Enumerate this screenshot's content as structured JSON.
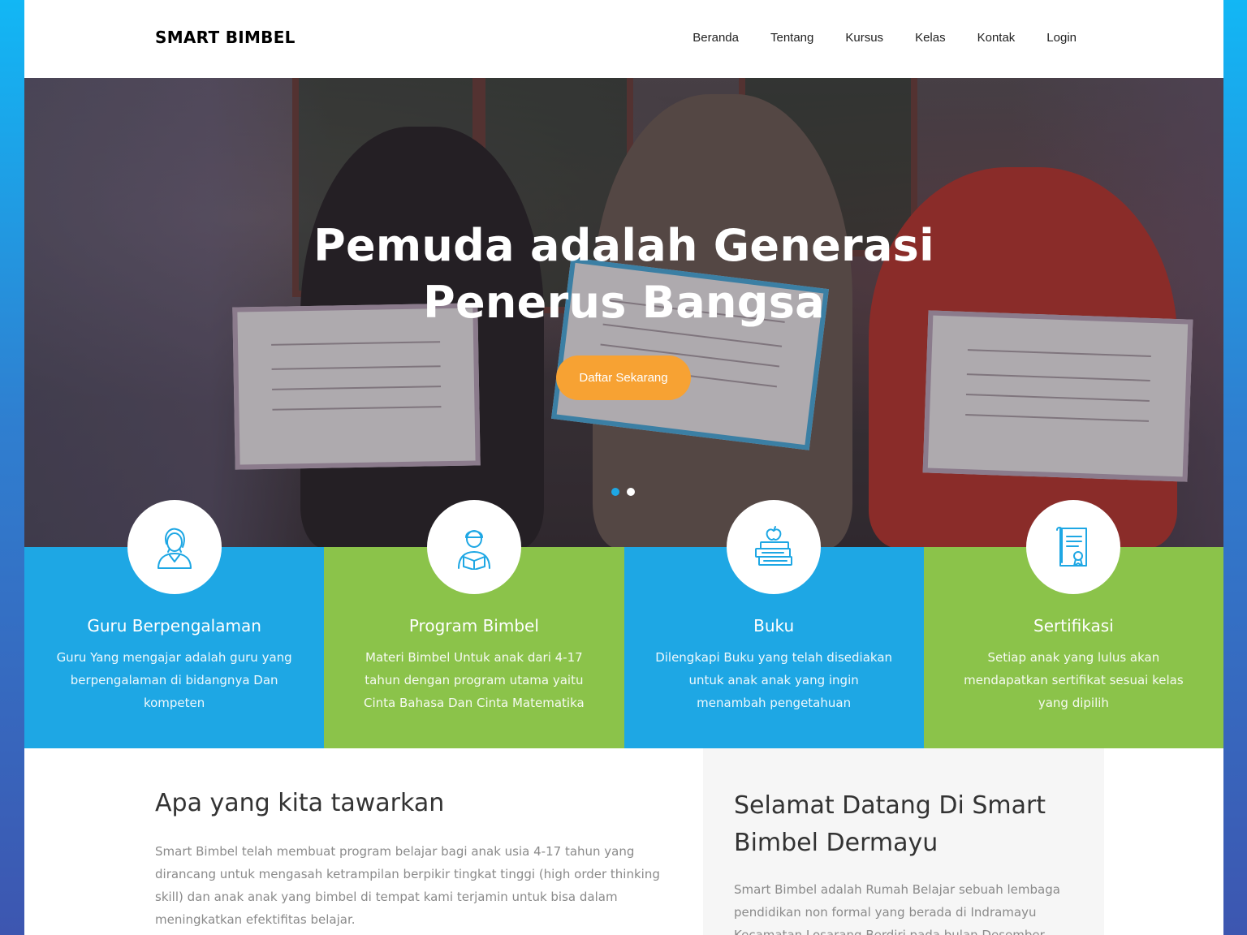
{
  "site": {
    "logo": "SMART BIMBEL"
  },
  "nav": {
    "items": [
      {
        "label": "Beranda"
      },
      {
        "label": "Tentang"
      },
      {
        "label": "Kursus"
      },
      {
        "label": "Kelas"
      },
      {
        "label": "Kontak"
      },
      {
        "label": "Login"
      }
    ]
  },
  "hero": {
    "title_line1": "Pemuda adalah Generasi",
    "title_line2": "Penerus Bangsa",
    "cta_label": "Daftar Sekarang",
    "slides": 2,
    "active_slide": 1
  },
  "features": [
    {
      "icon": "teacher-icon",
      "title": "Guru Berpengalaman",
      "text": "Guru Yang mengajar adalah guru yang berpengalaman di bidangnya Dan kompeten",
      "color": "#1ea7e4"
    },
    {
      "icon": "student-reading-icon",
      "title": "Program Bimbel",
      "text": "Materi Bimbel Untuk anak dari 4-17 tahun dengan program utama yaitu Cinta Bahasa Dan Cinta Matematika",
      "color": "#8bc34a"
    },
    {
      "icon": "books-apple-icon",
      "title": "Buku",
      "text": "Dilengkapi Buku yang telah disediakan untuk anak anak yang ingin menambah pengetahuan",
      "color": "#1ea7e4"
    },
    {
      "icon": "certificate-icon",
      "title": "Sertifikasi",
      "text": "Setiap anak yang lulus akan mendapatkan sertifikat sesuai kelas yang dipilih",
      "color": "#8bc34a"
    }
  ],
  "offer": {
    "title": "Apa yang kita tawarkan",
    "text": "Smart Bimbel telah membuat program belajar bagi anak usia 4-17 tahun yang dirancang untuk mengasah ketrampilan berpikir tingkat tinggi (high order thinking skill) dan anak anak yang bimbel di tempat kami terjamin untuk bisa dalam meningkatkan efektifitas belajar."
  },
  "welcome": {
    "title": "Selamat Datang Di Smart Bimbel Dermayu",
    "text": "Smart Bimbel adalah Rumah Belajar sebuah lembaga pendidikan non formal yang berada di Indramayu Kecamatan Losarang Berdiri pada bulan Desember"
  },
  "colors": {
    "accent_blue": "#1ea7e4",
    "accent_green": "#8bc34a",
    "cta_orange": "#f7a233"
  }
}
